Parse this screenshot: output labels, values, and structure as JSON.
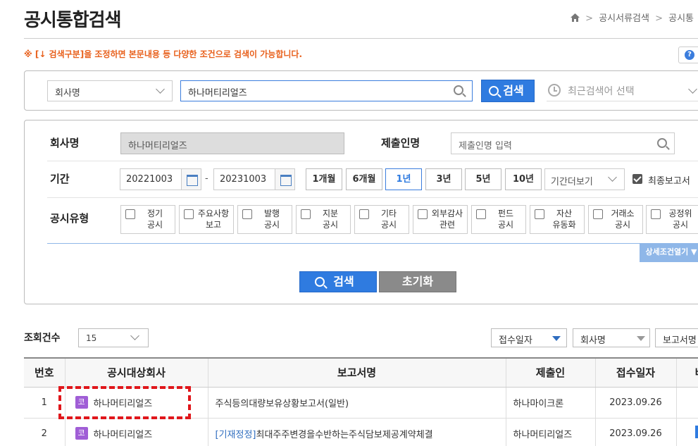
{
  "page_title": "공시통합검색",
  "breadcrumb": {
    "home_icon": "home-icon",
    "items": [
      "공시서류검색",
      "공시통"
    ]
  },
  "notice": "※ [↓ 검색구분]을 조정하면 본문내용 등 다양한 조건으로 검색이 가능합니다.",
  "help_icon": "?",
  "search": {
    "type_value": "회사명",
    "query_value": "하나머티리얼즈",
    "button_label": "검색",
    "recent_placeholder": "최근검색어 선택"
  },
  "filters": {
    "company_label": "회사명",
    "company_value": "하나머티리얼즈",
    "submitter_label": "제출인명",
    "submitter_placeholder": "제출인명 입력",
    "period_label": "기간",
    "date_from": "20221003",
    "date_to": "20231003",
    "date_sep": "-",
    "period_buttons": [
      "1개월",
      "6개월",
      "1년",
      "3년",
      "5년",
      "10년"
    ],
    "period_active": "1년",
    "more_period": "기간더보기",
    "final_report_label": "최종보고서",
    "final_report_checked": true,
    "type_label": "공시유형",
    "types": [
      "정기\n공시",
      "주요사항\n보고",
      "발행\n공시",
      "지분\n공시",
      "기타\n공시",
      "외부감사\n관련",
      "펀드\n공시",
      "자산\n유동화",
      "거래소\n공시",
      "공정위\n공시"
    ],
    "detail_toggle": "상세조건열기 ▼",
    "search_button": "검색",
    "reset_button": "초기화"
  },
  "results": {
    "count_label": "조회건수",
    "count_value": "15",
    "sort_options": [
      "접수일자",
      "회사명",
      "보고서명"
    ],
    "columns": [
      "번호",
      "공시대상회사",
      "보고서명",
      "제출인",
      "접수일자",
      "비"
    ],
    "rows": [
      {
        "no": "1",
        "badge": "코",
        "company": "하나머티리얼즈",
        "prefix": "",
        "report": "주식등의대량보유상황보고서(일반)",
        "submitter": "하나마이크론",
        "date": "2023.09.26"
      },
      {
        "no": "2",
        "badge": "코",
        "company": "하나머티리얼즈",
        "prefix": "[기재정정]",
        "report": "최대주주변경을수반하는주식담보제공계약체결",
        "submitter": "하나머티리얼즈",
        "date": "2023.09.26"
      }
    ]
  },
  "colors": {
    "accent": "#2f7be0",
    "notice": "#e8601c",
    "badge": "#a05ed6",
    "highlight": "#e0161b"
  }
}
